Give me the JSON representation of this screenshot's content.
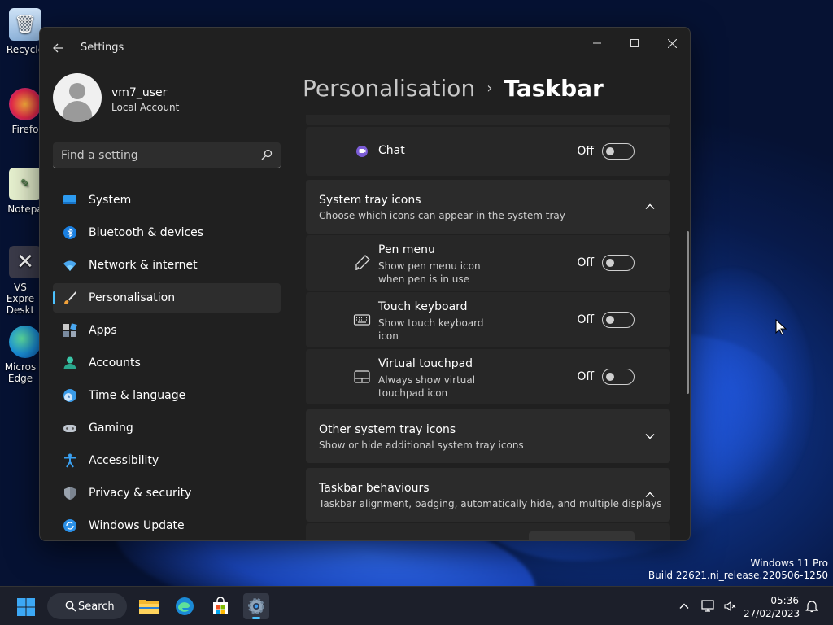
{
  "desktop": {
    "icons": [
      {
        "label": "Recycle",
        "icon": "recycle-bin-icon"
      },
      {
        "label": "Firefo",
        "icon": "firefox-icon"
      },
      {
        "label": "Notepa",
        "icon": "notepad-icon"
      },
      {
        "label": "VS Expre Deskt",
        "icon": "vs-express-icon"
      },
      {
        "label": "Micros Edge",
        "icon": "edge-icon"
      }
    ],
    "watermark_line1": "Windows 11 Pro",
    "watermark_line2": "Build 22621.ni_release.220506-1250"
  },
  "window": {
    "title": "Settings",
    "controls": {
      "minimize": "—",
      "maximize": "☐",
      "close": "✕"
    }
  },
  "profile": {
    "name": "vm7_user",
    "type": "Local Account"
  },
  "search": {
    "placeholder": "Find a setting"
  },
  "nav": {
    "items": [
      {
        "label": "System",
        "icon": "system-icon"
      },
      {
        "label": "Bluetooth & devices",
        "icon": "bluetooth-icon"
      },
      {
        "label": "Network & internet",
        "icon": "network-icon"
      },
      {
        "label": "Personalisation",
        "icon": "personalisation-brush-icon",
        "active": true
      },
      {
        "label": "Apps",
        "icon": "apps-icon"
      },
      {
        "label": "Accounts",
        "icon": "accounts-icon"
      },
      {
        "label": "Time & language",
        "icon": "time-language-icon"
      },
      {
        "label": "Gaming",
        "icon": "gaming-icon"
      },
      {
        "label": "Accessibility",
        "icon": "accessibility-icon"
      },
      {
        "label": "Privacy & security",
        "icon": "privacy-shield-icon"
      },
      {
        "label": "Windows Update",
        "icon": "windows-update-icon"
      }
    ]
  },
  "breadcrumb": {
    "parent": "Personalisation",
    "separator": "›",
    "current": "Taskbar"
  },
  "content": {
    "chat": {
      "label": "Chat",
      "state": "Off"
    },
    "system_tray": {
      "title": "System tray icons",
      "subtitle": "Choose which icons can appear in the system tray",
      "items": [
        {
          "label": "Pen menu",
          "sub1": "Show pen menu icon",
          "sub2": "when pen is in use",
          "state": "Off"
        },
        {
          "label": "Touch keyboard",
          "sub1": "Show touch keyboard",
          "sub2": "icon",
          "state": "Off"
        },
        {
          "label": "Virtual touchpad",
          "sub1": "Always show virtual",
          "sub2": "touchpad icon",
          "state": "Off"
        }
      ]
    },
    "other_tray": {
      "title": "Other system tray icons",
      "subtitle": "Show or hide additional system tray icons"
    },
    "behaviours": {
      "title": "Taskbar behaviours",
      "subtitle": "Taskbar alignment, badging, automatically hide, and multiple displays"
    }
  },
  "taskbar": {
    "search_label": "Search",
    "time": "05:36",
    "date": "27/02/2023"
  }
}
